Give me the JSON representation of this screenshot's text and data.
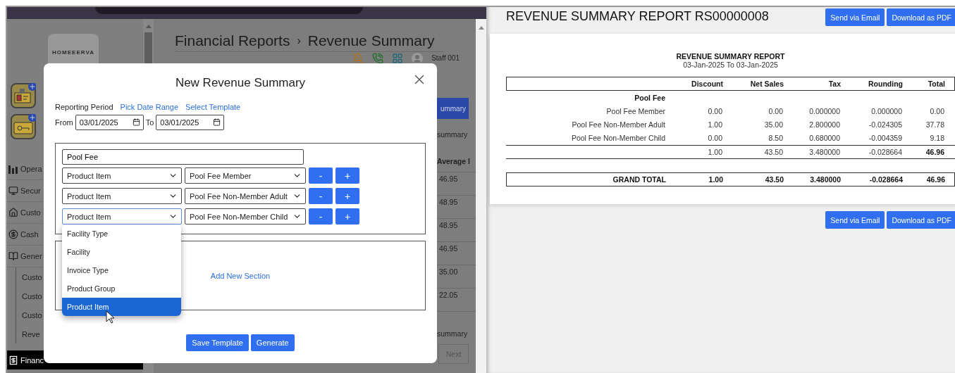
{
  "app": {
    "logo": "HOMEEERVA",
    "sidebar": {
      "items": [
        {
          "label": "Opera",
          "selected": false
        },
        {
          "label": "Secur",
          "selected": false
        },
        {
          "label": "Custo",
          "selected": false
        },
        {
          "label": "Cash",
          "selected": false
        },
        {
          "label": "Gener",
          "selected": false,
          "children": [
            {
              "label": "Custo",
              "selected": false
            },
            {
              "label": "Custo",
              "selected": false
            },
            {
              "label": "Custo",
              "selected": false
            },
            {
              "label": "Reve",
              "selected": false
            }
          ]
        },
        {
          "label": "Financ",
          "selected": true
        }
      ]
    },
    "breadcrumb": [
      "Financial Reports",
      "Revenue Summary"
    ],
    "separator": "›",
    "user": "Staff 001",
    "side_column": {
      "button": "ummary",
      "caption": "summary",
      "column_header": "Average I",
      "values": [
        "46.95",
        "48.95",
        "48.95",
        "46.95",
        "35.00",
        "22.05"
      ],
      "footer": "summary",
      "next": "Next"
    }
  },
  "modal": {
    "title": "New Revenue Summary",
    "reporting_label": "Reporting Period",
    "links": [
      "Pick Date Range",
      "Select Template"
    ],
    "from_label": "From",
    "from_value": "03/01/2025",
    "to_label": "To",
    "to_value": "03/01/2025",
    "section": {
      "name": "Pool Fee",
      "rows": [
        {
          "type": "Product Item",
          "item": "Pool Fee Member",
          "focused": false,
          "controls": [
            "-",
            "+"
          ]
        },
        {
          "type": "Product Item",
          "item": "Pool Fee Non-Member Adult",
          "focused": false,
          "controls": [
            "-",
            "+"
          ]
        },
        {
          "type": "Product Item",
          "item": "Pool Fee Non-Member Child",
          "focused": true,
          "controls": [
            "-",
            "+"
          ],
          "options": [
            {
              "label": "Facility Type",
              "selected": false
            },
            {
              "label": "Facility",
              "selected": false
            },
            {
              "label": "Invoice Type",
              "selected": false
            },
            {
              "label": "Product Group",
              "selected": false
            },
            {
              "label": "Product Item",
              "selected": true
            }
          ]
        }
      ]
    },
    "add_section": "Add New Section",
    "buttons": [
      "Save Template",
      "Generate"
    ]
  },
  "report": {
    "title": "REVENUE SUMMARY REPORT RS00000008",
    "buttons": [
      "Send via Email",
      "Download as PDF"
    ],
    "heading": "REVENUE SUMMARY REPORT",
    "period": "03-Jan-2025 To 03-Jan-2025",
    "columns": [
      "Discount",
      "Net Sales",
      "Tax",
      "Rounding",
      "Total"
    ],
    "group": {
      "name": "Pool Fee",
      "rows": [
        {
          "name": "Pool Fee Member",
          "values": [
            "0.00",
            "0.00",
            "0.000000",
            "0.000000",
            "0.00"
          ]
        },
        {
          "name": "Pool Fee Non-Member Adult",
          "values": [
            "1.00",
            "35.00",
            "2.800000",
            "-0.024305",
            "37.78"
          ]
        },
        {
          "name": "Pool Fee Non-Member Child",
          "values": [
            "0.00",
            "8.50",
            "0.680000",
            "-0.004359",
            "9.18"
          ]
        }
      ],
      "subtotal": [
        "1.00",
        "43.50",
        "3.480000",
        "-0.028664",
        "46.96"
      ]
    },
    "grand_total": {
      "label": "GRAND TOTAL",
      "values": [
        "1.00",
        "43.50",
        "3.480000",
        "-0.028664",
        "46.96"
      ]
    },
    "bottom_buttons": [
      "Send via Email",
      "Download as PDF"
    ]
  }
}
